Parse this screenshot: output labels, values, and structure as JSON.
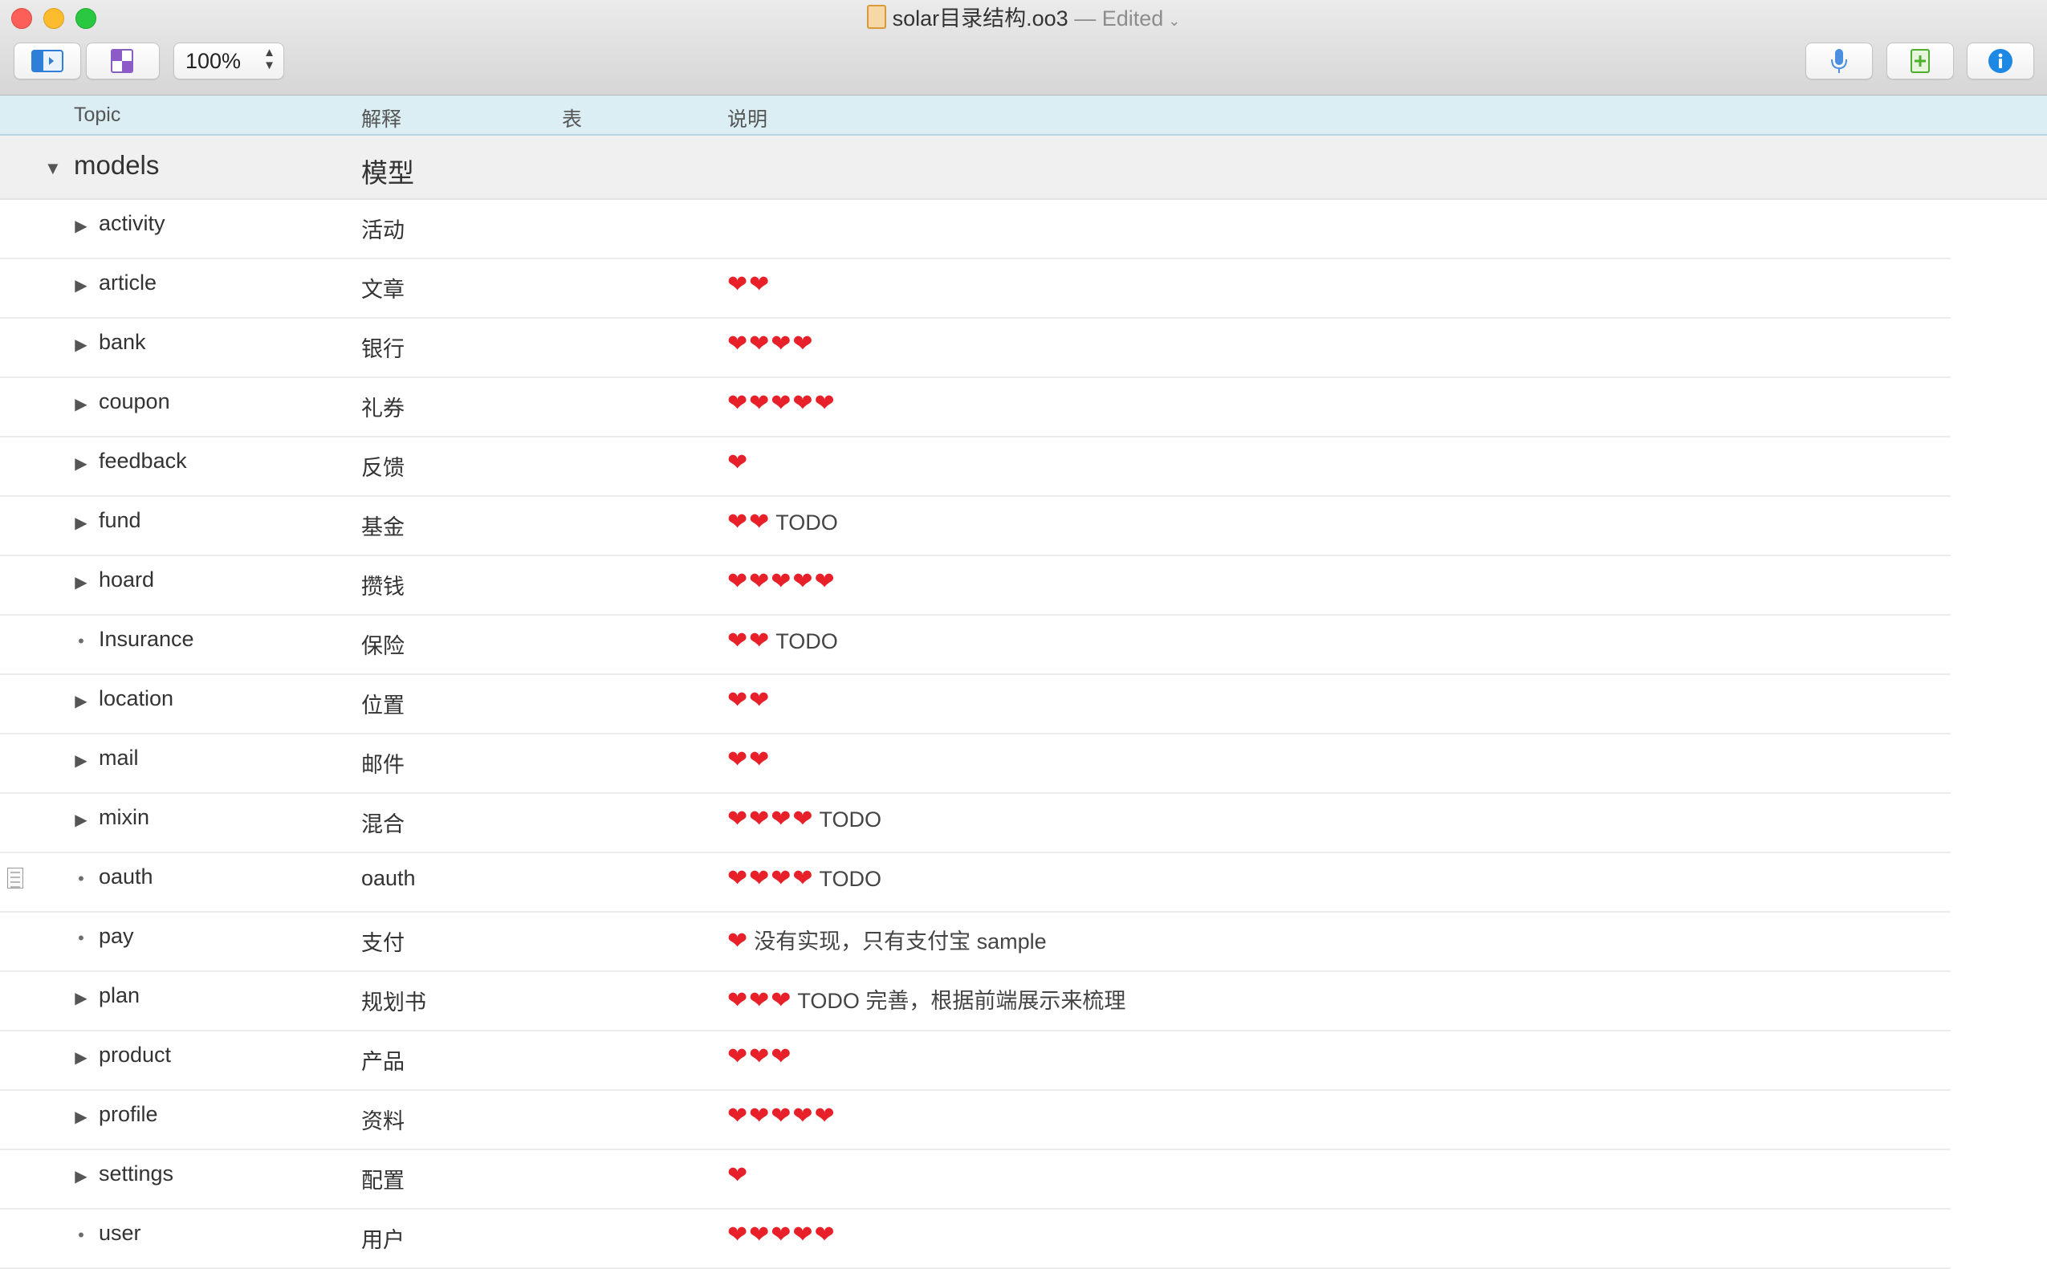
{
  "window": {
    "filename": "solar目录结构.oo3",
    "separator": "—",
    "status": "Edited"
  },
  "toolbar": {
    "zoom": "100%"
  },
  "columns": {
    "topic": "Topic",
    "explanation": "解释",
    "table": "表",
    "notes": "说明"
  },
  "parent": {
    "topic": "models",
    "explanation": "模型"
  },
  "rows": [
    {
      "topic": "activity",
      "explanation": "活动",
      "rating": 0,
      "note": "",
      "hearts": "",
      "expandable": true
    },
    {
      "topic": "article",
      "explanation": "文章",
      "rating": 2,
      "note": "",
      "hearts": "❤❤",
      "expandable": true
    },
    {
      "topic": "bank",
      "explanation": "银行",
      "rating": 4,
      "note": "",
      "hearts": "❤❤❤❤",
      "expandable": true
    },
    {
      "topic": "coupon",
      "explanation": "礼券",
      "rating": 5,
      "note": "",
      "hearts": "❤❤❤❤❤",
      "expandable": true
    },
    {
      "topic": "feedback",
      "explanation": "反馈",
      "rating": 1,
      "note": "",
      "hearts": "❤",
      "expandable": true
    },
    {
      "topic": "fund",
      "explanation": "基金",
      "rating": 2,
      "note": "TODO",
      "hearts": "❤❤",
      "expandable": true
    },
    {
      "topic": "hoard",
      "explanation": "攒钱",
      "rating": 5,
      "note": "",
      "hearts": "❤❤❤❤❤",
      "expandable": true
    },
    {
      "topic": "Insurance",
      "explanation": "保险",
      "rating": 2,
      "note": "TODO",
      "hearts": "❤❤",
      "expandable": false
    },
    {
      "topic": "location",
      "explanation": "位置",
      "rating": 2,
      "note": "",
      "hearts": "❤❤",
      "expandable": true
    },
    {
      "topic": "mail",
      "explanation": "邮件",
      "rating": 2,
      "note": "",
      "hearts": "❤❤",
      "expandable": true
    },
    {
      "topic": "mixin",
      "explanation": "混合",
      "rating": 4,
      "note": "TODO",
      "hearts": "❤❤❤❤",
      "expandable": true
    },
    {
      "topic": "oauth",
      "explanation": "oauth",
      "rating": 4,
      "note": "TODO",
      "hearts": "❤❤❤❤",
      "expandable": false,
      "has_note_icon": true
    },
    {
      "topic": "pay",
      "explanation": "支付",
      "rating": 1,
      "note": "没有实现，只有支付宝 sample",
      "hearts": "❤",
      "expandable": false
    },
    {
      "topic": "plan",
      "explanation": "规划书",
      "rating": 3,
      "note": "TODO 完善，根据前端展示来梳理",
      "hearts": "❤❤❤",
      "expandable": true
    },
    {
      "topic": "product",
      "explanation": "产品",
      "rating": 3,
      "note": "",
      "hearts": "❤❤❤",
      "expandable": true
    },
    {
      "topic": "profile",
      "explanation": "资料",
      "rating": 5,
      "note": "",
      "hearts": "❤❤❤❤❤",
      "expandable": true
    },
    {
      "topic": "settings",
      "explanation": "配置",
      "rating": 1,
      "note": "",
      "hearts": "❤",
      "expandable": true
    },
    {
      "topic": "user",
      "explanation": "用户",
      "rating": 5,
      "note": "",
      "hearts": "❤❤❤❤❤",
      "expandable": false
    }
  ],
  "icons": {
    "heart": "red-heart-icon",
    "expand": "disclosure-triangle-icon",
    "leaf": "bullet-icon"
  },
  "colors": {
    "header_bg": "#daeef3",
    "heart": "#e8202a"
  }
}
